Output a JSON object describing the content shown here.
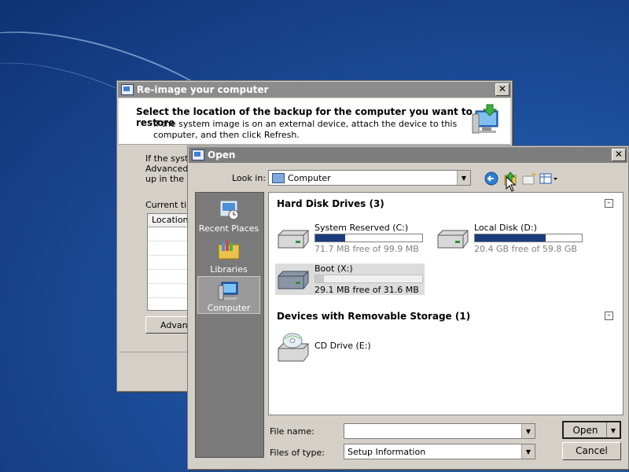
{
  "reimage_window": {
    "title": "Re-image your computer",
    "heading": "Select the location of the backup for the computer you want to restore",
    "description": "If the system image is on an external device, attach the device to this computer, and then click Refresh.",
    "body_line1": "If the syste",
    "body_line2": "Advanced",
    "body_line3": "up in the lis",
    "current_time_label": "Current tim",
    "location_header": "Location",
    "advanced_button": "Advanc"
  },
  "open_dialog": {
    "title": "Open",
    "look_in_label": "Look in:",
    "look_in_value": "Computer",
    "places": [
      {
        "label": "Recent Places",
        "icon": "recent-places-icon"
      },
      {
        "label": "Libraries",
        "icon": "libraries-icon"
      },
      {
        "label": "Computer",
        "icon": "computer-icon",
        "selected": true
      }
    ],
    "groups": {
      "hard_disks": {
        "label": "Hard Disk Drives (3)",
        "drives": [
          {
            "name": "System Reserved (C:)",
            "free": "71.7 MB free of 99.9 MB",
            "used_fraction": 0.28
          },
          {
            "name": "Local Disk (D:)",
            "free": "20.4 GB free of 59.8 GB",
            "used_fraction": 0.66
          },
          {
            "name": "Boot (X:)",
            "free": "29.1 MB free of 31.6 MB",
            "used_fraction": 0.08,
            "selected": true
          }
        ]
      },
      "removable": {
        "label": "Devices with Removable Storage (1)",
        "drives": [
          {
            "name": "CD Drive (E:)",
            "icon": "cd-drive-icon"
          }
        ]
      }
    },
    "file_name_label": "File name:",
    "file_name_value": "",
    "file_type_label": "Files of type:",
    "file_type_value": "Setup Information",
    "open_button": "Open",
    "cancel_button": "Cancel"
  },
  "colors": {
    "desktop": "#1d4f9c",
    "dialog_face": "#d4d0c8",
    "usage_bar": "#1b3c7d"
  }
}
